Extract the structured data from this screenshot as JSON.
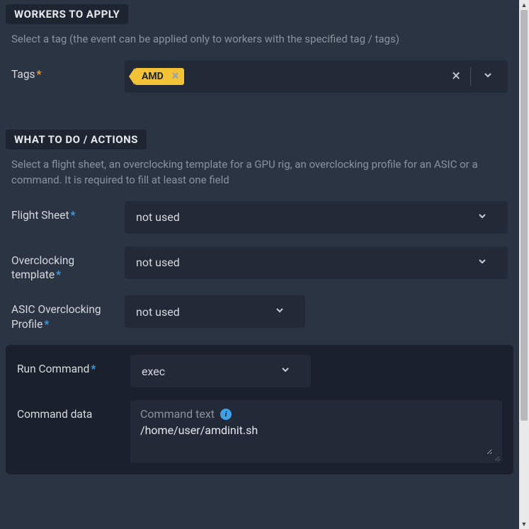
{
  "workers": {
    "header": "WORKERS TO APPLY",
    "desc": "Select a tag (the event can be applied only to workers with the specified tag / tags)",
    "tags_label": "Tags",
    "tag_value": "AMD"
  },
  "actions": {
    "header": "WHAT TO DO / ACTIONS",
    "desc": "Select a flight sheet, an overclocking template for a GPU rig, an overclocking profile for an ASIC or a command. It is required to fill at least one field",
    "flight_sheet": {
      "label": "Flight Sheet",
      "value": "not used"
    },
    "oc_template": {
      "label": "Overclocking template",
      "value": "not used"
    },
    "asic_profile": {
      "label": "ASIC Overclocking Profile",
      "value": "not used"
    },
    "run_command": {
      "label": "Run Command",
      "value": "exec"
    },
    "command_data": {
      "label": "Command data",
      "placeholder": "Command text",
      "value": "/home/user/amdinit.sh"
    }
  }
}
